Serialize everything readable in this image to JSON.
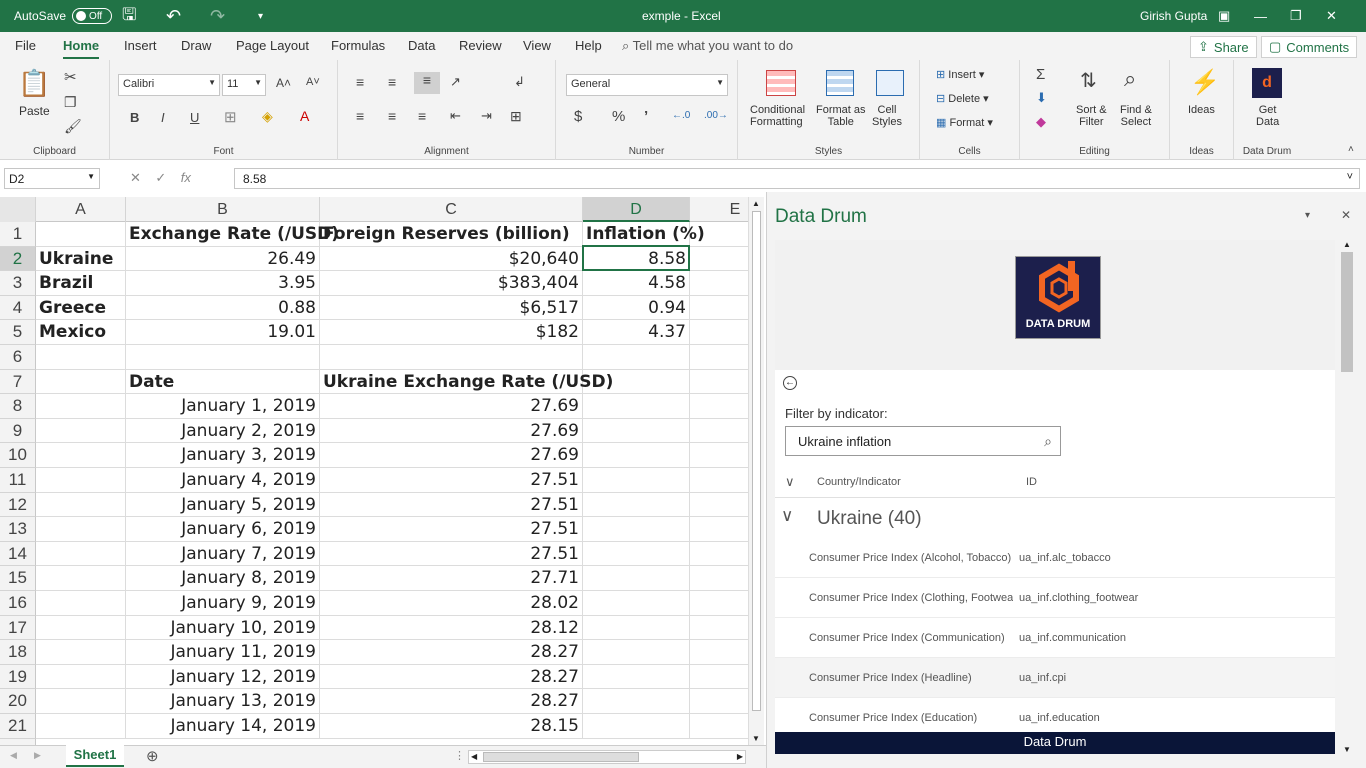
{
  "titlebar": {
    "autosave_label": "AutoSave",
    "autosave_state": "Off",
    "doc_title": "exmple  -  Excel",
    "user": "Girish Gupta"
  },
  "tabs": [
    "File",
    "Home",
    "Insert",
    "Draw",
    "Page Layout",
    "Formulas",
    "Data",
    "Review",
    "View",
    "Help"
  ],
  "tell_me": "Tell me what you want to do",
  "share_label": "Share",
  "comments_label": "Comments",
  "ribbon": {
    "paste": "Paste",
    "clipboard": "Clipboard",
    "font_name": "Calibri",
    "font_size": "11",
    "font": "Font",
    "alignment": "Alignment",
    "number_format": "General",
    "number": "Number",
    "cond_fmt": "Conditional",
    "cond_fmt2": "Formatting",
    "fmt_table": "Format as",
    "fmt_table2": "Table",
    "cell_styles": "Cell",
    "cell_styles2": "Styles",
    "styles": "Styles",
    "insert": "Insert",
    "delete": "Delete",
    "format": "Format",
    "cells": "Cells",
    "sort": "Sort &",
    "sort2": "Filter",
    "find": "Find &",
    "find2": "Select",
    "editing": "Editing",
    "ideas": "Ideas",
    "ideas_group": "Ideas",
    "get_data": "Get",
    "get_data2": "Data",
    "data_drum_group": "Data Drum"
  },
  "formula_bar": {
    "name_box": "D2",
    "fx": "fx",
    "value": "8.58"
  },
  "columns": [
    "A",
    "B",
    "C",
    "D",
    "E"
  ],
  "rows": [
    "1",
    "2",
    "3",
    "4",
    "5",
    "6",
    "7",
    "8",
    "9",
    "10",
    "11",
    "12",
    "13",
    "14",
    "15",
    "16",
    "17",
    "18",
    "19",
    "20",
    "21"
  ],
  "cells": {
    "header": {
      "b": "Exchange Rate (/USD)",
      "c": "Foreign Reserves (billion)",
      "d": "Inflation (%)"
    },
    "countries": [
      {
        "name": "Ukraine",
        "rate": "26.49",
        "reserves": "$20,640",
        "inflation": "8.58"
      },
      {
        "name": "Brazil",
        "rate": "3.95",
        "reserves": "$383,404",
        "inflation": "4.58"
      },
      {
        "name": "Greece",
        "rate": "0.88",
        "reserves": "$6,517",
        "inflation": "0.94"
      },
      {
        "name": "Mexico",
        "rate": "19.01",
        "reserves": "$182",
        "inflation": "4.37"
      }
    ],
    "series_header": {
      "b": "Date",
      "c": "Ukraine Exchange Rate (/USD)"
    },
    "series": [
      {
        "date": "January 1, 2019",
        "rate": "27.69"
      },
      {
        "date": "January 2, 2019",
        "rate": "27.69"
      },
      {
        "date": "January 3, 2019",
        "rate": "27.69"
      },
      {
        "date": "January 4, 2019",
        "rate": "27.51"
      },
      {
        "date": "January 5, 2019",
        "rate": "27.51"
      },
      {
        "date": "January 6, 2019",
        "rate": "27.51"
      },
      {
        "date": "January 7, 2019",
        "rate": "27.51"
      },
      {
        "date": "January 8, 2019",
        "rate": "27.71"
      },
      {
        "date": "January 9, 2019",
        "rate": "28.02"
      },
      {
        "date": "January 10, 2019",
        "rate": "28.12"
      },
      {
        "date": "January 11, 2019",
        "rate": "28.27"
      },
      {
        "date": "January 12, 2019",
        "rate": "28.27"
      },
      {
        "date": "January 13, 2019",
        "rate": "28.27"
      },
      {
        "date": "January 14, 2019",
        "rate": "28.15"
      }
    ]
  },
  "sheet_tab": "Sheet1",
  "pane": {
    "title": "Data Drum",
    "logo_text": "DATA DRUM",
    "filter_label": "Filter by indicator:",
    "filter_value": "Ukraine inflation",
    "col_country": "Country/Indicator",
    "col_id": "ID",
    "group": "Ukraine (40)",
    "items": [
      {
        "name": "Consumer Price Index (Alcohol, Tobacco)",
        "id": "ua_inf.alc_tobacco"
      },
      {
        "name": "Consumer Price Index (Clothing, Footwear)",
        "id": "ua_inf.clothing_footwear"
      },
      {
        "name": "Consumer Price Index (Communication)",
        "id": "ua_inf.communication"
      },
      {
        "name": "Consumer Price Index (Headline)",
        "id": "ua_inf.cpi"
      },
      {
        "name": "Consumer Price Index (Education)",
        "id": "ua_inf.education"
      }
    ],
    "footer": "Data Drum"
  },
  "colors": {
    "accent": "#217346",
    "logo_bg": "#1c1f4c",
    "logo_orange": "#f26522",
    "footer_bg": "#0a1538"
  }
}
